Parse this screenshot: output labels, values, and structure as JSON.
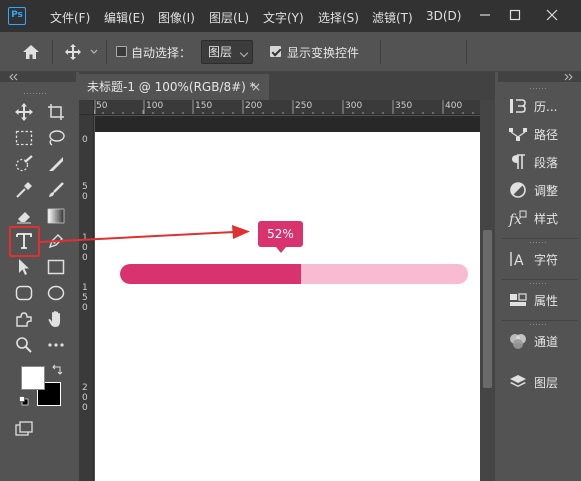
{
  "app": {
    "logo": "Ps"
  },
  "menu": [
    "文件(F)",
    "编辑(E)",
    "图像(I)",
    "图层(L)",
    "文字(Y)",
    "选择(S)",
    "滤镜(T)",
    "3D(D)"
  ],
  "options": {
    "auto_select_label": "自动选择：",
    "auto_select_checked": false,
    "layer_select_value": "图层",
    "show_transform_label": "显示变换控件",
    "show_transform_checked": true
  },
  "document": {
    "tab_title": "未标题-1 @ 100%(RGB/8#) *",
    "close_glyph": "×",
    "ruler_h_labels": [
      "50",
      "100",
      "150",
      "200",
      "250",
      "300",
      "350",
      "400"
    ],
    "ruler_v_labels": [
      "0",
      "5",
      "0",
      "1",
      "0",
      "0",
      "1",
      "5",
      "0",
      "2",
      "0",
      "0"
    ]
  },
  "panels": [
    {
      "label": "历...",
      "icon": "history-icon"
    },
    {
      "label": "路径",
      "icon": "paths-icon"
    },
    {
      "label": "段落",
      "icon": "paragraph-icon"
    },
    {
      "label": "调整",
      "icon": "adjustments-icon"
    },
    {
      "label": "样式",
      "icon": "styles-icon"
    },
    {
      "label": "字符",
      "icon": "character-icon"
    },
    {
      "label": "属性",
      "icon": "properties-icon"
    },
    {
      "label": "通道",
      "icon": "channels-icon"
    },
    {
      "label": "图层",
      "icon": "layers-icon"
    }
  ],
  "progress": {
    "label": "52%",
    "value": 0.52
  },
  "colors": {
    "accent": "#d8336f",
    "track": "#f8bbd2",
    "highlight": "#e03030",
    "arrow": "#e03030"
  }
}
